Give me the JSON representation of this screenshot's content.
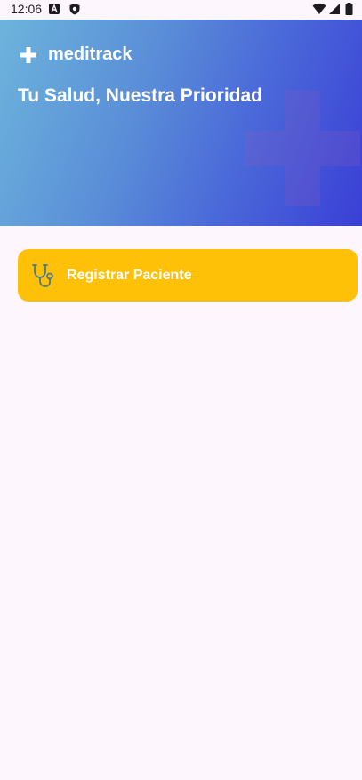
{
  "status_bar": {
    "time": "12:06",
    "icons": [
      "a-notification-icon",
      "shield-icon",
      "wifi-icon",
      "signal-icon",
      "battery-icon"
    ]
  },
  "header": {
    "brand_name": "meditrack",
    "brand_icon": "plus-icon",
    "tagline": "Tu Salud, Nuestra Prioridad",
    "background_icon": "medical-cross-icon",
    "gradient_colors": [
      "#6db4dc",
      "#3a3fd6"
    ]
  },
  "actions": {
    "register_patient": {
      "label": "Registrar Paciente",
      "icon": "stethoscope-icon",
      "color": "#ffc107"
    }
  },
  "colors": {
    "background": "#fdf6fd",
    "text_on_primary": "#ffffff"
  }
}
